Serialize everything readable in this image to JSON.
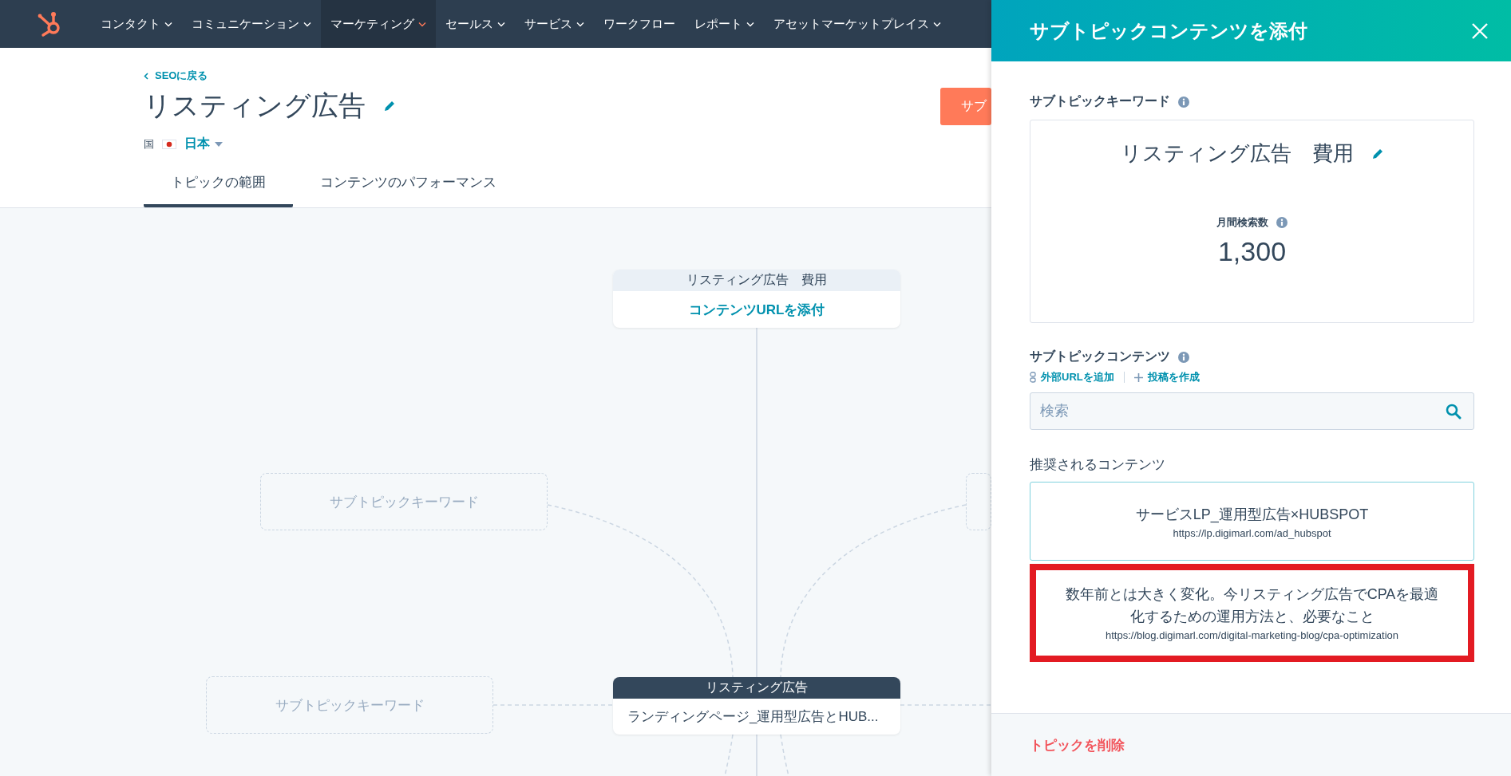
{
  "nav": {
    "items": [
      {
        "label": "コンタクト",
        "dropdown": true,
        "selected": false
      },
      {
        "label": "コミュニケーション",
        "dropdown": true,
        "selected": false
      },
      {
        "label": "マーケティング",
        "dropdown": true,
        "selected": true
      },
      {
        "label": "セールス",
        "dropdown": true,
        "selected": false
      },
      {
        "label": "サービス",
        "dropdown": true,
        "selected": false
      },
      {
        "label": "ワークフロー",
        "dropdown": false,
        "selected": false
      },
      {
        "label": "レポート",
        "dropdown": true,
        "selected": false
      },
      {
        "label": "アセットマーケットプレイス",
        "dropdown": true,
        "selected": false
      }
    ]
  },
  "header": {
    "back_link": "SEOに戻る",
    "title": "リスティング広告",
    "country_label": "国",
    "country": "日本",
    "primary_button": "サブ",
    "tabs": [
      {
        "label": "トピックの範囲",
        "selected": true
      },
      {
        "label": "コンテンツのパフォーマンス",
        "selected": false
      }
    ]
  },
  "map": {
    "nodes": [
      {
        "kind": "subtopic",
        "keyword": "リスティング広告　費用",
        "action": "コンテンツURLを添付"
      },
      {
        "kind": "placeholder",
        "label": "サブトピックキーワード"
      },
      {
        "kind": "placeholder"
      },
      {
        "kind": "placeholder",
        "label": "サブトピックキーワード"
      },
      {
        "kind": "pillar",
        "keyword": "リスティング広告",
        "content": "ランディングページ_運用型広告とHUB..."
      }
    ]
  },
  "panel": {
    "title": "サブトピックコンテンツを添付",
    "keyword_label": "サブトピックキーワード",
    "keyword": "リスティング広告　費用",
    "volume_label": "月間検索数",
    "volume": "1,300",
    "content_label": "サブトピックコンテンツ",
    "add_url_link": "外部URLを追加",
    "create_post_link": "投稿を作成",
    "search": {
      "placeholder": "検索"
    },
    "suggested_label": "推奨されるコンテンツ",
    "suggestions": [
      {
        "title": "サービスLP_運用型広告×HUBSPOT",
        "url": "https://lp.digimarl.com/ad_hubspot",
        "highlighted": false
      },
      {
        "title": "数年前とは大きく変化。今リスティング広告でCPAを最適化するための運用方法と、必要なこと",
        "url": "https://blog.digimarl.com/digital-marketing-blog/cpa-optimization",
        "highlighted": true
      }
    ],
    "delete_link": "トピックを削除"
  }
}
